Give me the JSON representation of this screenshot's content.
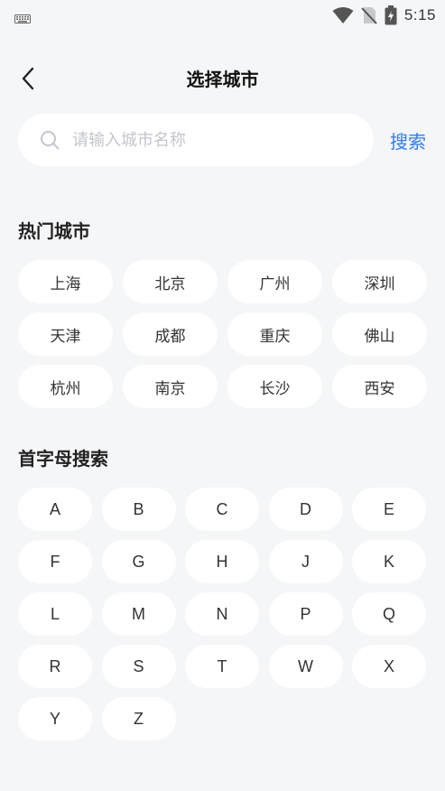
{
  "status_bar": {
    "time": "5:15",
    "icons": [
      "keyboard-icon",
      "wifi-icon",
      "no-sim-icon",
      "battery-charging-icon"
    ]
  },
  "header": {
    "back_icon": "chevron-left-icon",
    "title": "选择城市"
  },
  "search": {
    "placeholder": "请输入城市名称",
    "value": "",
    "button_label": "搜索",
    "accent_color": "#2f7cf6"
  },
  "hot_cities": {
    "title": "热门城市",
    "items": [
      "上海",
      "北京",
      "广州",
      "深圳",
      "天津",
      "成都",
      "重庆",
      "佛山",
      "杭州",
      "南京",
      "长沙",
      "西安"
    ]
  },
  "letter_search": {
    "title": "首字母搜索",
    "letters": [
      "A",
      "B",
      "C",
      "D",
      "E",
      "F",
      "G",
      "H",
      "J",
      "K",
      "L",
      "M",
      "N",
      "P",
      "Q",
      "R",
      "S",
      "T",
      "W",
      "X",
      "Y",
      "Z"
    ]
  }
}
